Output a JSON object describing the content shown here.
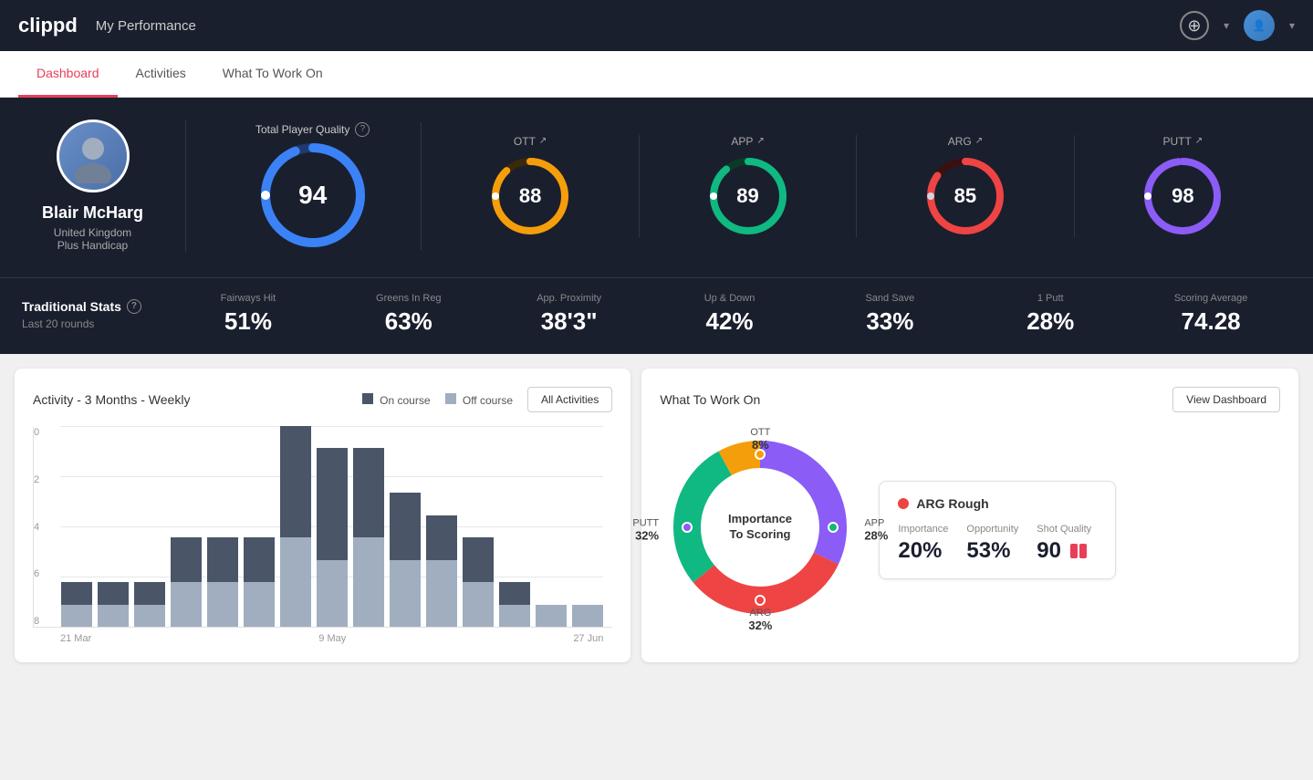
{
  "app": {
    "logo": "clippd",
    "nav_title": "My Performance"
  },
  "tabs": [
    {
      "id": "dashboard",
      "label": "Dashboard",
      "active": true
    },
    {
      "id": "activities",
      "label": "Activities",
      "active": false
    },
    {
      "id": "what-to-work-on",
      "label": "What To Work On",
      "active": false
    }
  ],
  "player": {
    "name": "Blair McHarg",
    "country": "United Kingdom",
    "handicap": "Plus Handicap"
  },
  "scores": {
    "total": {
      "label": "Total Player Quality",
      "value": 94,
      "color": "#3b82f6",
      "track_color": "#1e3a6e",
      "pct": 94
    },
    "ott": {
      "label": "OTT",
      "value": 88,
      "color": "#f59e0b",
      "track_color": "#3a2a0a",
      "pct": 88
    },
    "app": {
      "label": "APP",
      "value": 89,
      "color": "#10b981",
      "track_color": "#0a3a28",
      "pct": 89
    },
    "arg": {
      "label": "ARG",
      "value": 85,
      "color": "#ef4444",
      "track_color": "#3a1010",
      "pct": 85
    },
    "putt": {
      "label": "PUTT",
      "value": 98,
      "color": "#8b5cf6",
      "track_color": "#2d1a5e",
      "pct": 98
    }
  },
  "trad_stats": {
    "heading": "Traditional Stats",
    "period": "Last 20 rounds",
    "stats": [
      {
        "label": "Fairways Hit",
        "value": "51%"
      },
      {
        "label": "Greens In Reg",
        "value": "63%"
      },
      {
        "label": "App. Proximity",
        "value": "38'3\""
      },
      {
        "label": "Up & Down",
        "value": "42%"
      },
      {
        "label": "Sand Save",
        "value": "33%"
      },
      {
        "label": "1 Putt",
        "value": "28%"
      },
      {
        "label": "Scoring Average",
        "value": "74.28"
      }
    ]
  },
  "activity_chart": {
    "title": "Activity - 3 Months - Weekly",
    "legend_on": "On course",
    "legend_off": "Off course",
    "all_btn": "All Activities",
    "y_labels": [
      "0",
      "2",
      "4",
      "6",
      "8"
    ],
    "x_labels": [
      "21 Mar",
      "9 May",
      "27 Jun"
    ],
    "bars": [
      {
        "on": 1,
        "off": 1
      },
      {
        "on": 1,
        "off": 1
      },
      {
        "on": 1,
        "off": 1
      },
      {
        "on": 2,
        "off": 2
      },
      {
        "on": 2,
        "off": 2
      },
      {
        "on": 2,
        "off": 2
      },
      {
        "on": 5,
        "off": 4
      },
      {
        "on": 5,
        "off": 3
      },
      {
        "on": 4,
        "off": 4
      },
      {
        "on": 3,
        "off": 3
      },
      {
        "on": 2,
        "off": 3
      },
      {
        "on": 2,
        "off": 2
      },
      {
        "on": 1,
        "off": 1
      },
      {
        "on": 0,
        "off": 1
      },
      {
        "on": 0,
        "off": 1
      }
    ]
  },
  "what_to_work_on": {
    "title": "What To Work On",
    "view_btn": "View Dashboard",
    "donut_center_line1": "Importance",
    "donut_center_line2": "To Scoring",
    "segments": [
      {
        "label": "OTT",
        "pct": "8%",
        "color": "#f59e0b"
      },
      {
        "label": "APP",
        "pct": "28%",
        "color": "#10b981"
      },
      {
        "label": "ARG",
        "pct": "32%",
        "color": "#ef4444"
      },
      {
        "label": "PUTT",
        "pct": "32%",
        "color": "#8b5cf6"
      }
    ],
    "detail_card": {
      "title": "ARG Rough",
      "dot_color": "#ef4444",
      "metrics": [
        {
          "label": "Importance",
          "value": "20%"
        },
        {
          "label": "Opportunity",
          "value": "53%"
        },
        {
          "label": "Shot Quality",
          "value": "90"
        }
      ]
    }
  }
}
